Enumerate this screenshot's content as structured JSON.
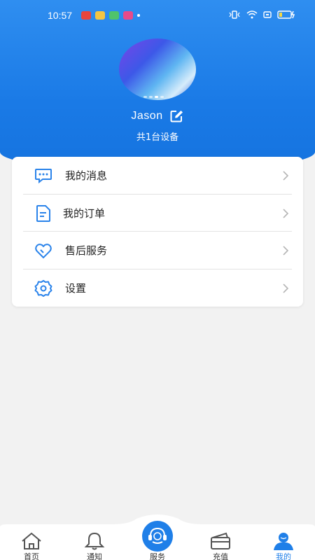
{
  "status_bar": {
    "time": "10:57",
    "battery_icon": "battery-icon",
    "wifi_icon": "wifi-icon"
  },
  "colors": {
    "header_blue": "#1a7ae6",
    "accent_blue": "#1f7fe8",
    "icon_blue": "#2a83ea",
    "background": "#f2f2f2"
  },
  "profile": {
    "username": "Jason",
    "device_count": "共1台设备",
    "edit_icon": "edit-icon"
  },
  "menu": {
    "items": [
      {
        "label": "我的消息",
        "icon": "message-icon"
      },
      {
        "label": "我的订单",
        "icon": "order-icon"
      },
      {
        "label": "售后服务",
        "icon": "heart-service-icon"
      },
      {
        "label": "设置",
        "icon": "gear-icon"
      }
    ]
  },
  "tabbar": {
    "tabs": [
      {
        "label": "首页",
        "icon": "home-icon"
      },
      {
        "label": "通知",
        "icon": "bell-icon"
      },
      {
        "label": "服务",
        "icon": "customer-service-icon"
      },
      {
        "label": "充值",
        "icon": "wallet-icon"
      },
      {
        "label": "我的",
        "icon": "user-icon"
      }
    ],
    "active": "我的"
  }
}
